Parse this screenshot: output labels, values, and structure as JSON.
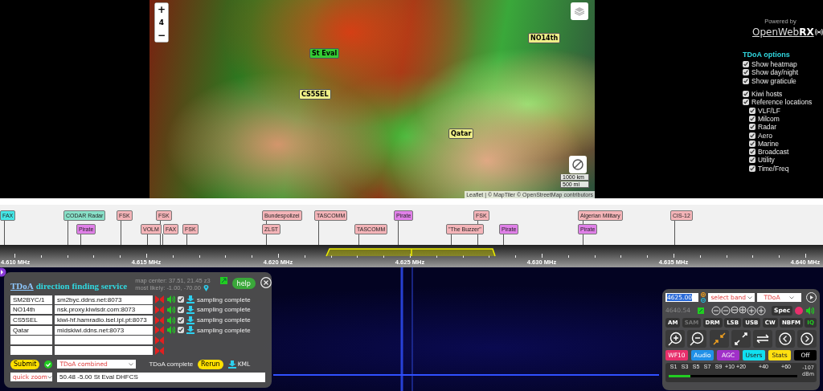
{
  "map": {
    "zoom_in": "+",
    "zoom_level": "4",
    "zoom_out": "−",
    "markers": [
      {
        "label": "St Eval",
        "color": "#33cc33"
      },
      {
        "label": "NO14th",
        "color": "#eeee88"
      },
      {
        "label": "CS5SEL",
        "color": "#eeee88"
      },
      {
        "label": "Qatar",
        "color": "#eeee88"
      }
    ],
    "scale": [
      "1000 km",
      "500 mi"
    ],
    "attribution": "Leaflet | © MapTiler © OpenStreetMap contributors"
  },
  "branding": {
    "powered_by": "Powered by",
    "logo_light": "OpenWeb",
    "logo_bold": "RX"
  },
  "tdoa_options": {
    "title": "TDoA options",
    "groups": [
      [
        {
          "label": "Show heatmap",
          "checked": true
        },
        {
          "label": "Show day/night",
          "checked": true
        },
        {
          "label": "Show graticule",
          "checked": true
        }
      ],
      [
        {
          "label": "Kiwi hosts",
          "checked": true
        },
        {
          "label": "Reference locations",
          "checked": true,
          "children": [
            {
              "label": "VLF/LF",
              "checked": true
            },
            {
              "label": "Milcom",
              "checked": true
            },
            {
              "label": "Radar",
              "checked": true
            },
            {
              "label": "Aero",
              "checked": true
            },
            {
              "label": "Marine",
              "checked": true
            },
            {
              "label": "Broadcast",
              "checked": true
            },
            {
              "label": "Utility",
              "checked": true
            },
            {
              "label": "Time/Freq",
              "checked": true
            }
          ]
        }
      ]
    ]
  },
  "bookmarks": [
    {
      "label": "FAX",
      "color": "#44e6e6"
    },
    {
      "label": "CODAR Radar",
      "color": "#88e0c8"
    },
    {
      "label": "Pirate",
      "color": "#e080e8"
    },
    {
      "label": "FSK",
      "color": "#f4b4b8"
    },
    {
      "label": "VOLM",
      "color": "#f4b4b8"
    },
    {
      "label": "FSK",
      "color": "#f4b4b8"
    },
    {
      "label": "FAX",
      "color": "#f4b4b8"
    },
    {
      "label": "FSK",
      "color": "#f4b4b8"
    },
    {
      "label": "Bundespolizei",
      "color": "#f4b4b8"
    },
    {
      "label": "ZLST",
      "color": "#f4b4b8"
    },
    {
      "label": "TASCOMM",
      "color": "#f4b4b8"
    },
    {
      "label": "TASCOMM",
      "color": "#f4b4b8"
    },
    {
      "label": "Pirate",
      "color": "#e080e8"
    },
    {
      "label": "\"The Buzzer\"",
      "color": "#f4b4b8"
    },
    {
      "label": "FSK",
      "color": "#f4b4b8"
    },
    {
      "label": "Pirate",
      "color": "#e080e8"
    },
    {
      "label": "Algerian Military",
      "color": "#f4b4b8"
    },
    {
      "label": "Pirate",
      "color": "#e080e8"
    },
    {
      "label": "CIS-12",
      "color": "#f4b4b8"
    }
  ],
  "frequency_scale": [
    "4.610 MHz",
    "4.615 MHz",
    "4.620 MHz",
    "4.625 MHz",
    "4.630 MHz",
    "4.635 MHz",
    "4.640 MHz"
  ],
  "tdoa_panel": {
    "title_link": "TDoA",
    "title": "direction finding service",
    "map_center": "map center: 37.51, 21.45 z3",
    "most_likely": "most likely: -1.00, -70.00",
    "help": "help",
    "hosts": [
      {
        "kind": "host",
        "name": "SM2BYC/1",
        "url": "sm2byc.ddns.net:8073",
        "checked": true,
        "status": "sampling complete"
      },
      {
        "kind": "host",
        "name": "NO14th",
        "url": "nsk.proxy.kiwisdr.com:8073",
        "checked": true,
        "status": "sampling complete"
      },
      {
        "kind": "host",
        "name": "CS5SEL",
        "url": "kiwi-hf.hamradio.isel.ipl.pt:8073",
        "checked": true,
        "status": "sampling complete"
      },
      {
        "kind": "host",
        "name": "Qatar",
        "url": "midskiwi.ddns.net:8073",
        "checked": true,
        "status": "sampling complete"
      },
      {
        "kind": "empty"
      },
      {
        "kind": "empty"
      }
    ],
    "submit": "Submit",
    "result_select": "TDoA combined",
    "result_status": "TDoA complete",
    "rerun": "Rerun",
    "kml": "KML",
    "quick_zoom": "quick zoom",
    "location": "50.48 -5.00 St Eval DHFCS"
  },
  "control_panel": {
    "frequency": "4625.00",
    "band_select": "select band",
    "extension_select": "TDoA",
    "secondary_frequency": "4640.54",
    "spec": "Spec",
    "modes": [
      {
        "label": "AM",
        "selected": false,
        "disabled": false
      },
      {
        "label": "SAM",
        "selected": false,
        "disabled": true
      },
      {
        "label": "DRM",
        "selected": false,
        "disabled": false
      },
      {
        "label": "LSB",
        "selected": false,
        "disabled": false
      },
      {
        "label": "USB",
        "selected": false,
        "disabled": false
      },
      {
        "label": "CW",
        "selected": false,
        "disabled": false
      },
      {
        "label": "NBFM",
        "selected": false,
        "disabled": false
      },
      {
        "label": "IQ",
        "selected": true,
        "disabled": false
      }
    ],
    "toggles": [
      {
        "label": "WF10",
        "color": "#e8306c"
      },
      {
        "label": "Audio",
        "color": "#2090e8"
      },
      {
        "label": "AGC",
        "color": "#a030c8"
      },
      {
        "label": "Users",
        "color": "#10e0f0"
      },
      {
        "label": "Stats",
        "color": "#ffe010"
      },
      {
        "label": "Off",
        "color": "#000000"
      }
    ],
    "smeter": {
      "labels": [
        "S1",
        "S3",
        "S5",
        "S7",
        "S9",
        "+10",
        "+20",
        "+40",
        "+60"
      ],
      "level": 0.17,
      "reading": "-107",
      "unit": "dBm"
    }
  }
}
